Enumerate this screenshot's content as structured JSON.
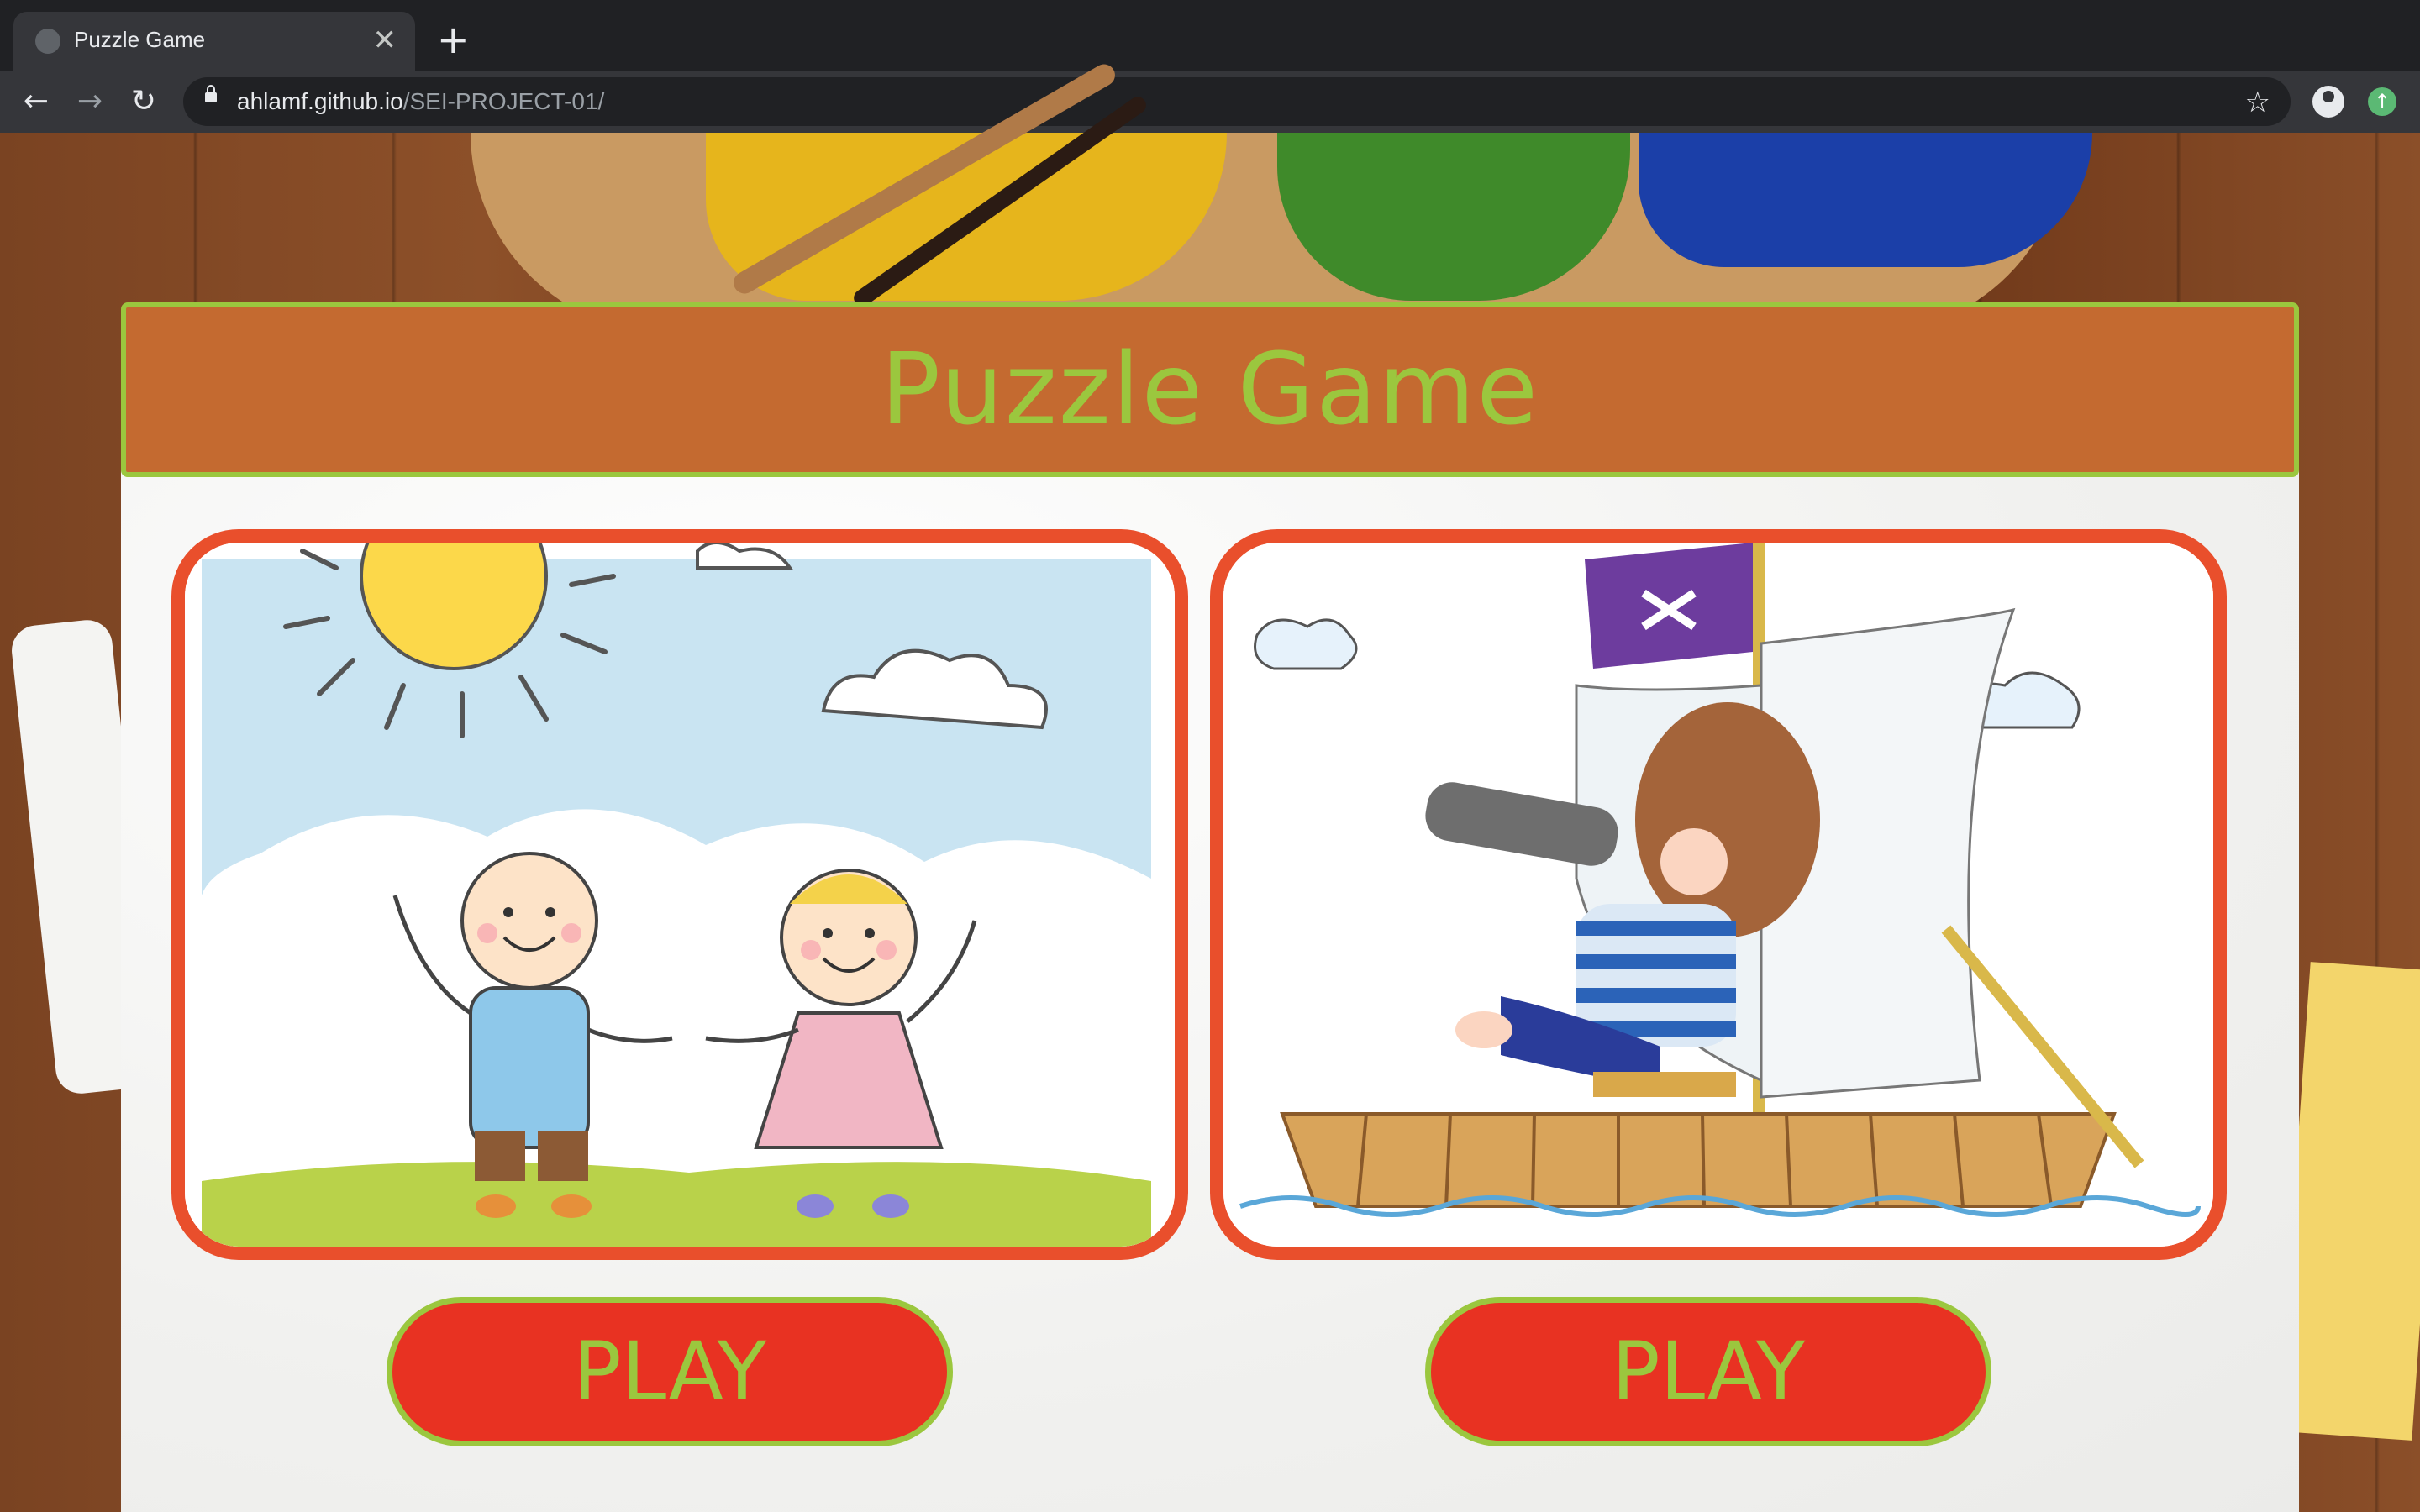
{
  "browser": {
    "tab_title": "Puzzle Game",
    "tab_close": "✕",
    "new_tab": "+",
    "url_host": "ahlamf.github.io",
    "url_path": "/SEI-PROJECT-01/",
    "back": "←",
    "forward": "→",
    "reload": "↻",
    "bookmark": "☆",
    "update": "↑"
  },
  "page": {
    "title": "Puzzle Game",
    "puzzles": [
      {
        "image": "kids-holding-hands-drawing",
        "button_label": "PLAY"
      },
      {
        "image": "boy-on-raft-with-telescope",
        "button_label": "PLAY"
      }
    ]
  },
  "colors": {
    "header_bg": "#c46a30",
    "accent_green": "#9bc73e",
    "frame_orange": "#e94f2c",
    "button_red": "#e83222"
  }
}
